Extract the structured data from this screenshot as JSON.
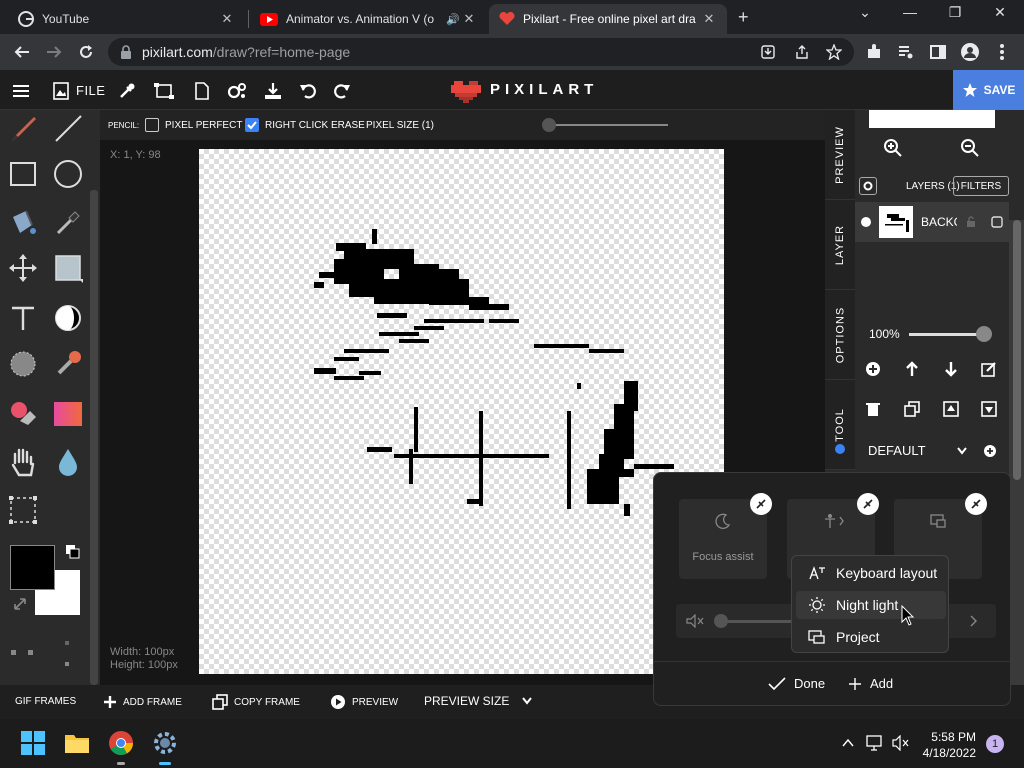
{
  "browser": {
    "tabs": [
      {
        "title": "YouTube",
        "icon": "youtube-icon",
        "active": false
      },
      {
        "title": "Animator vs. Animation V (o",
        "icon": "youtube-icon",
        "active": false
      },
      {
        "title": "Pixilart - Free online pixel art dra",
        "icon": "pixilart-heart-icon",
        "active": true
      }
    ],
    "url_host": "pixilart.com",
    "url_path": "/draw?ref=home-page"
  },
  "app": {
    "file_label": "FILE",
    "logo": "PIXILART",
    "save_label": "SAVE",
    "accent_color": "#4a7fe0"
  },
  "options_bar": {
    "tool_name": "PENCIL:",
    "pixel_perfect": "PIXEL PERFECT",
    "pixel_perfect_checked": false,
    "right_click_erase": "RIGHT CLICK ERASE",
    "right_click_erase_checked": true,
    "pixel_size": "PIXEL SIZE (1)"
  },
  "canvas": {
    "coords": "X: 1, Y: 98",
    "width_label": "Width: 100px",
    "height_label": "Height: 100px"
  },
  "right_panel": {
    "tabs": [
      "PREVIEW",
      "LAYER",
      "OPTIONS",
      "TOOL"
    ],
    "layers_label": "LAYERS (1)",
    "filters_label": "FILTERS",
    "layer_name": "BACKG",
    "opacity": "100%",
    "preset": "DEFAULT"
  },
  "frames_bar": {
    "gif_frames": "GIF FRAMES",
    "add_frame": "ADD FRAME",
    "copy_frame": "COPY FRAME",
    "preview": "PREVIEW",
    "preview_size": "PREVIEW SIZE"
  },
  "quick_settings": {
    "tiles": [
      {
        "label": "Focus assist"
      },
      {
        "label": ""
      },
      {
        "label": ""
      }
    ],
    "add_menu": [
      {
        "label": "Keyboard layout",
        "icon": "keyboard-layout-icon"
      },
      {
        "label": "Night light",
        "icon": "night-light-icon"
      },
      {
        "label": "Project",
        "icon": "project-icon"
      }
    ],
    "done_label": "Done",
    "add_label": "Add"
  },
  "taskbar": {
    "time": "5:58 PM",
    "date": "4/18/2022",
    "notification_count": "1"
  }
}
